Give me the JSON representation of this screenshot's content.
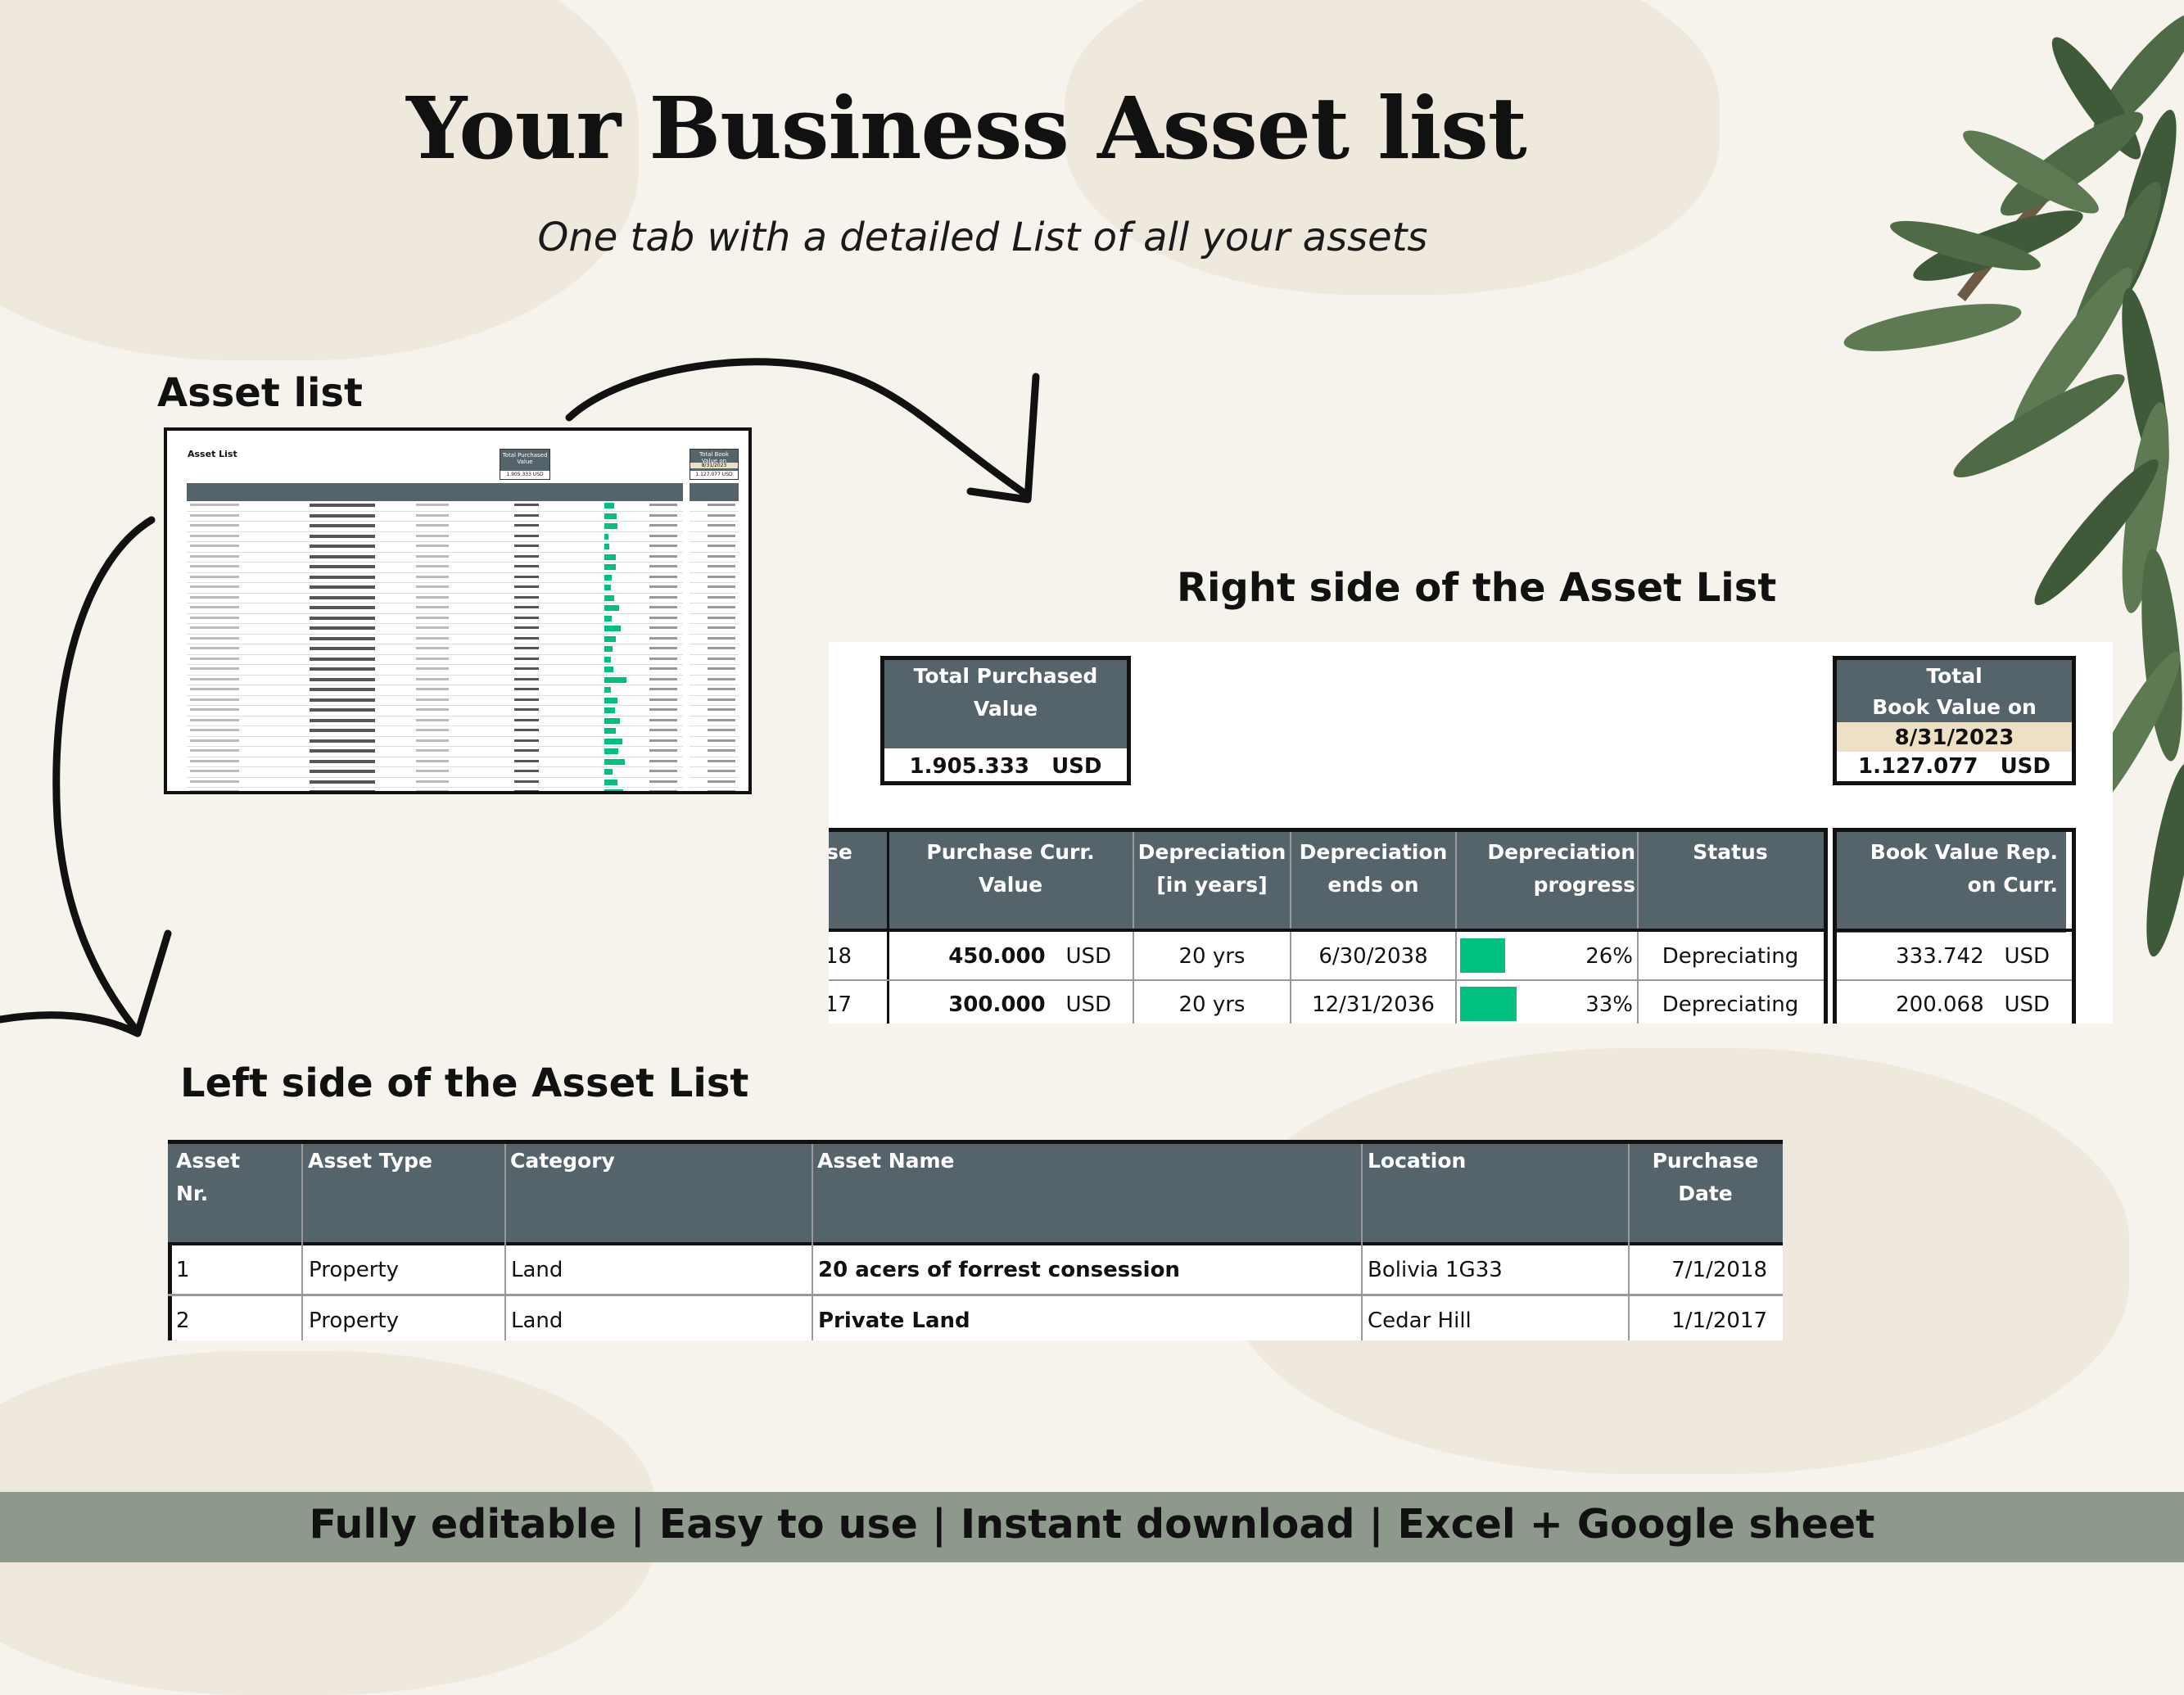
{
  "title": "Your Business Asset list",
  "subtitle": "One tab with a detailed List of all your assets",
  "labels": {
    "asset_list": "Asset list",
    "right_side": "Right side of the Asset List",
    "left_side": "Left side of the Asset List"
  },
  "thumbnail": {
    "title": "Asset List",
    "total_label": "Total Purchased Value",
    "total_value": "1.905.333 USD",
    "book_label": "Total Book Value on",
    "book_date": "8/31/2023",
    "book_value": "1.127.077 USD"
  },
  "right_side": {
    "total_purchased": {
      "label_line1": "Total Purchased",
      "label_line2": "Value",
      "amount": "1.905.333",
      "currency": "USD"
    },
    "total_book": {
      "label_line1": "Total",
      "label_line2": "Book Value on",
      "date": "8/31/2023",
      "amount": "1.127.077",
      "currency": "USD"
    },
    "columns": [
      {
        "line1": "se",
        "line2": ""
      },
      {
        "line1": "Purchase  Curr.",
        "line2": "Value"
      },
      {
        "line1": "Depreciation",
        "line2": "[in years]"
      },
      {
        "line1": "Depreciation",
        "line2": "ends on"
      },
      {
        "line1": "Depreciation",
        "line2": "progress"
      },
      {
        "line1": "Status",
        "line2": ""
      }
    ],
    "book_column": {
      "line1": "Book Value  Rep.",
      "line2": "on Curr."
    },
    "rows": [
      {
        "date_tail": "18",
        "value": "450.000",
        "currency": "USD",
        "years": "20 yrs",
        "ends": "6/30/2038",
        "progress": 26,
        "progress_label": "26%",
        "status": "Depreciating",
        "book": "333.742",
        "book_currency": "USD"
      },
      {
        "date_tail": "17",
        "value": "300.000",
        "currency": "USD",
        "years": "20 yrs",
        "ends": "12/31/2036",
        "progress": 33,
        "progress_label": "33%",
        "status": "Depreciating",
        "book": "200.068",
        "book_currency": "USD"
      }
    ]
  },
  "left_side": {
    "columns": [
      {
        "line1": "Asset",
        "line2": "Nr."
      },
      {
        "line1": "Asset Type",
        "line2": ""
      },
      {
        "line1": "Category",
        "line2": ""
      },
      {
        "line1": "Asset Name",
        "line2": ""
      },
      {
        "line1": "Location",
        "line2": ""
      },
      {
        "line1": "Purchase",
        "line2": "Date"
      }
    ],
    "rows": [
      {
        "nr": "1",
        "type": "Property",
        "category": "Land",
        "name": "20 acers of forrest consession",
        "location": "Bolivia 1G33",
        "date": "7/1/2018"
      },
      {
        "nr": "2",
        "type": "Property",
        "category": "Land",
        "name": "Private Land",
        "location": "Cedar Hill",
        "date": "1/1/2017"
      }
    ]
  },
  "footer": "Fully editable | Easy to use | Instant download | Excel + Google sheet",
  "colors": {
    "header_bg": "#55636b",
    "progress": "#00c07f",
    "date_highlight": "#ede0c4",
    "footer_band": "#8d9a8b"
  }
}
